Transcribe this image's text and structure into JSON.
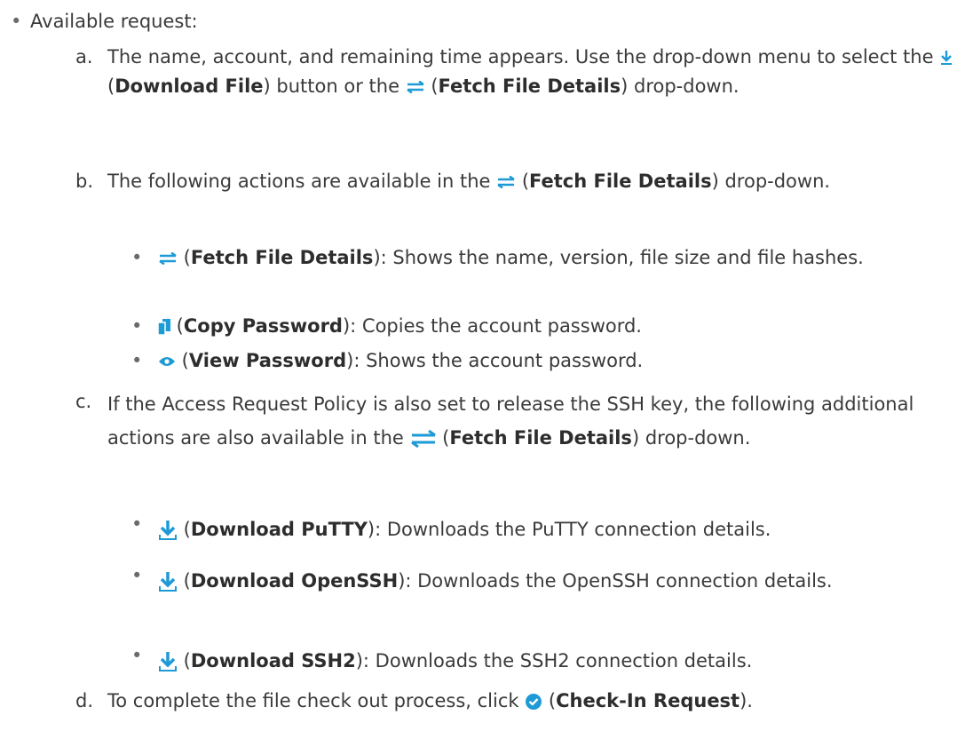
{
  "heading": "Available request:",
  "items": {
    "a": {
      "label": "a.",
      "pre": "The name, account, and remaining time appears. Use the drop-down menu to select the",
      "btn1": "Download File",
      "mid": "button or the",
      "btn2": "Fetch File Details",
      "post": "drop-down."
    },
    "b": {
      "label": "b.",
      "pre": "The following actions are available in the",
      "btn": "Fetch File Details",
      "post": "drop-down.",
      "subs": [
        {
          "name": "Fetch File Details",
          "desc": ": Shows the name, version, file size and file hashes."
        },
        {
          "name": "Copy Password",
          "desc": ": Copies the account password."
        },
        {
          "name": "View Password",
          "desc": ": Shows the account password."
        }
      ]
    },
    "c": {
      "label": "c.",
      "pre": "If the Access Request Policy is also set to release the SSH key, the following additional actions are also available in the",
      "btn": "Fetch File Details",
      "post": "drop-down.",
      "subs": [
        {
          "name": "Download PuTTY",
          "desc": ": Downloads the PuTTY connection details."
        },
        {
          "name": "Download OpenSSH",
          "desc": ": Downloads the OpenSSH connection details."
        },
        {
          "name": "Download SSH2",
          "desc": ": Downloads the SSH2 connection details."
        }
      ]
    },
    "d": {
      "label": "d.",
      "pre": "To complete the file check out process, click",
      "btn": "Check-In Request",
      "post": ")."
    }
  },
  "paren_open": "(",
  "paren_close": ")",
  "colors": {
    "icon_blue": "#1e9ad6",
    "text": "#3a3a3a"
  }
}
